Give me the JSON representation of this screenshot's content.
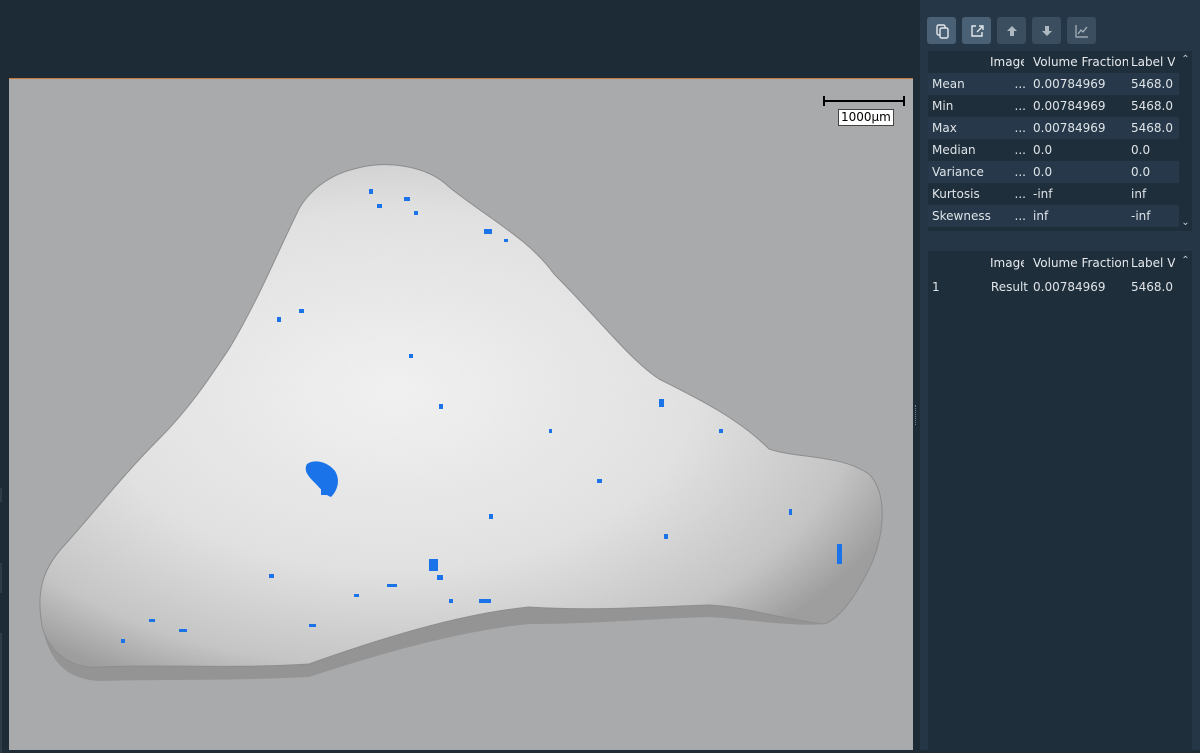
{
  "viewer": {
    "scalebar_label": "1000µm",
    "overlay_color": "#1a73e8"
  },
  "toolbar": {
    "buttons": [
      {
        "icon": "copy-icon"
      },
      {
        "icon": "export-icon"
      },
      {
        "icon": "arrow-up-icon"
      },
      {
        "icon": "arrow-down-icon"
      },
      {
        "icon": "chart-icon"
      }
    ]
  },
  "stats_table": {
    "headers": [
      "",
      "Image",
      "Volume Fraction",
      "Label Vo"
    ],
    "rows": [
      {
        "name": "Mean",
        "image": "...",
        "volume_fraction": "0.00784969",
        "label_vo": "5468.0"
      },
      {
        "name": "Min",
        "image": "...",
        "volume_fraction": "0.00784969",
        "label_vo": "5468.0"
      },
      {
        "name": "Max",
        "image": "...",
        "volume_fraction": "0.00784969",
        "label_vo": "5468.0"
      },
      {
        "name": "Median",
        "image": "...",
        "volume_fraction": "0.0",
        "label_vo": "0.0"
      },
      {
        "name": "Variance",
        "image": "...",
        "volume_fraction": "0.0",
        "label_vo": "0.0"
      },
      {
        "name": "Kurtosis",
        "image": "...",
        "volume_fraction": "-inf",
        "label_vo": "inf"
      },
      {
        "name": "Skewness",
        "image": "...",
        "volume_fraction": "inf",
        "label_vo": "-inf"
      }
    ]
  },
  "results_table": {
    "headers": [
      "",
      "Image",
      "Volume Fraction",
      "Label Vo"
    ],
    "rows": [
      {
        "name": "1",
        "image": "Result",
        "volume_fraction": "0.00784969",
        "label_vo": "5468.0"
      }
    ]
  },
  "colors": {
    "panel_bg": "#253646",
    "table_bg": "#1f2e3b",
    "accent_line": "#c97a3a"
  }
}
